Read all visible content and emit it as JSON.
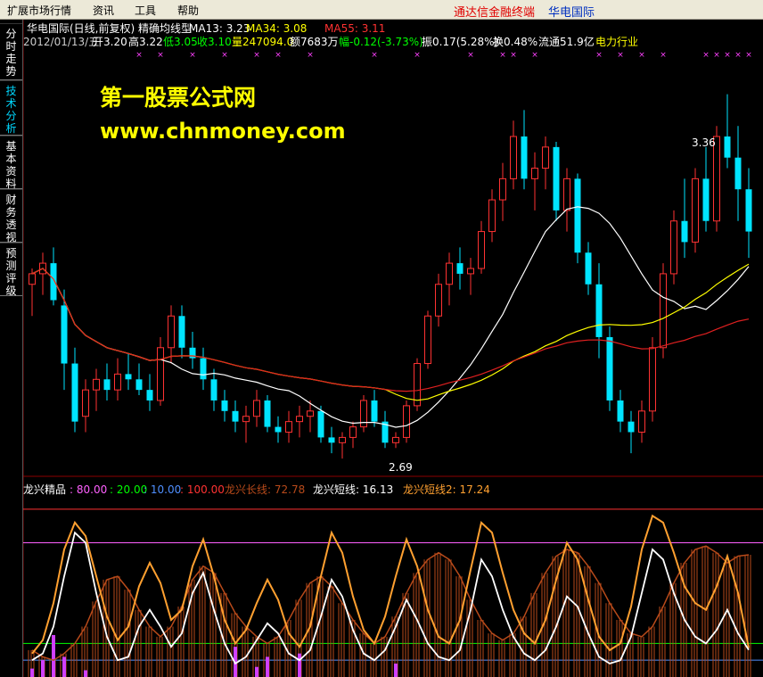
{
  "menu": {
    "items": [
      "扩展市场行情",
      "资讯",
      "工具",
      "帮助"
    ],
    "brand": "通达信金融终端",
    "stock_name": "华电国际"
  },
  "sidebar": {
    "tabs": [
      "分时走势",
      "技术分析",
      "基本资料",
      "财务透视",
      "预测评级"
    ],
    "active": "技术分析"
  },
  "header": {
    "title": "华电国际(日线,前复权) 精确均线型",
    "ma13_label": "MA13: 3.23",
    "ma34_label": "MA34: 3.08",
    "ma55_label": "MA55: 3.11",
    "date": "2012/01/13/五",
    "open": "开3.20",
    "high": "高3.22",
    "low": "低3.05",
    "close": "收3.10",
    "volume": "量247094.0",
    "amount": "额7683万",
    "change": "幅-0.12(-3.73%)",
    "amplitude": "振0.17(5.28%)",
    "turnover": "换0.48%",
    "float_cap": "流通51.9亿",
    "industry": "电力行业"
  },
  "watermark": {
    "line1": "第一股票公式网",
    "line2": "www.chnmoney.com"
  },
  "annotations": {
    "high": "3.36",
    "low": "2.69"
  },
  "indicator": {
    "name": "龙兴精品",
    "v1": ": 80.00",
    "v2": ": 20.00",
    "v3": ": 10.00",
    "v4": ": 100.00",
    "long_line": "龙兴长线: 72.78",
    "short_line": "龙兴短线: 16.13",
    "short_line2": "龙兴短线2: 17.24"
  },
  "colors": {
    "up": "#ff3232",
    "down": "#00e4ff",
    "ma13": "#ffffff",
    "ma34": "#ffff00",
    "ma55": "#e02020",
    "marker": "#ff40ff",
    "long_line": "#b84a1a",
    "short_line": "#ffffff",
    "short_line2": "#ffa030",
    "line80": "#ff60ff",
    "line20": "#00ff00",
    "line10": "#4f8fff",
    "line100": "#ff3030"
  },
  "chart_data": {
    "type": "candlestick",
    "candles": [
      [
        3.0,
        3.03,
        2.94,
        3.02
      ],
      [
        3.02,
        3.06,
        2.98,
        3.04
      ],
      [
        3.04,
        3.07,
        2.96,
        2.97
      ],
      [
        2.96,
        2.99,
        2.8,
        2.85
      ],
      [
        2.85,
        2.88,
        2.72,
        2.74
      ],
      [
        2.75,
        2.82,
        2.72,
        2.8
      ],
      [
        2.8,
        2.84,
        2.76,
        2.82
      ],
      [
        2.82,
        2.85,
        2.78,
        2.8
      ],
      [
        2.8,
        2.86,
        2.78,
        2.83
      ],
      [
        2.83,
        2.87,
        2.8,
        2.82
      ],
      [
        2.82,
        2.85,
        2.79,
        2.8
      ],
      [
        2.8,
        2.83,
        2.76,
        2.78
      ],
      [
        2.78,
        2.9,
        2.77,
        2.88
      ],
      [
        2.88,
        2.96,
        2.85,
        2.94
      ],
      [
        2.94,
        2.96,
        2.86,
        2.88
      ],
      [
        2.88,
        2.91,
        2.84,
        2.86
      ],
      [
        2.86,
        2.88,
        2.8,
        2.82
      ],
      [
        2.82,
        2.84,
        2.76,
        2.78
      ],
      [
        2.78,
        2.8,
        2.74,
        2.76
      ],
      [
        2.76,
        2.78,
        2.72,
        2.74
      ],
      [
        2.74,
        2.77,
        2.7,
        2.75
      ],
      [
        2.75,
        2.8,
        2.73,
        2.78
      ],
      [
        2.78,
        2.79,
        2.72,
        2.73
      ],
      [
        2.73,
        2.75,
        2.7,
        2.72
      ],
      [
        2.72,
        2.76,
        2.7,
        2.74
      ],
      [
        2.74,
        2.77,
        2.71,
        2.75
      ],
      [
        2.75,
        2.78,
        2.72,
        2.76
      ],
      [
        2.76,
        2.77,
        2.7,
        2.71
      ],
      [
        2.71,
        2.73,
        2.68,
        2.7
      ],
      [
        2.7,
        2.72,
        2.67,
        2.71
      ],
      [
        2.71,
        2.74,
        2.69,
        2.73
      ],
      [
        2.73,
        2.79,
        2.72,
        2.78
      ],
      [
        2.78,
        2.8,
        2.73,
        2.74
      ],
      [
        2.74,
        2.76,
        2.69,
        2.7
      ],
      [
        2.7,
        2.72,
        2.69,
        2.71
      ],
      [
        2.71,
        2.78,
        2.7,
        2.77
      ],
      [
        2.77,
        2.86,
        2.76,
        2.85
      ],
      [
        2.85,
        2.95,
        2.84,
        2.94
      ],
      [
        2.94,
        3.02,
        2.92,
        3.0
      ],
      [
        3.0,
        3.06,
        2.96,
        3.04
      ],
      [
        3.04,
        3.07,
        2.99,
        3.02
      ],
      [
        3.02,
        3.05,
        2.98,
        3.03
      ],
      [
        3.03,
        3.12,
        3.02,
        3.1
      ],
      [
        3.1,
        3.18,
        3.08,
        3.16
      ],
      [
        3.16,
        3.23,
        3.12,
        3.2
      ],
      [
        3.2,
        3.31,
        3.18,
        3.28
      ],
      [
        3.28,
        3.33,
        3.18,
        3.2
      ],
      [
        3.2,
        3.25,
        3.14,
        3.22
      ],
      [
        3.22,
        3.28,
        3.18,
        3.26
      ],
      [
        3.26,
        3.27,
        3.12,
        3.14
      ],
      [
        3.14,
        3.22,
        3.1,
        3.2
      ],
      [
        3.2,
        3.21,
        3.04,
        3.06
      ],
      [
        3.06,
        3.08,
        2.98,
        3.0
      ],
      [
        3.0,
        3.04,
        2.86,
        2.9
      ],
      [
        2.9,
        2.92,
        2.76,
        2.78
      ],
      [
        2.78,
        2.8,
        2.72,
        2.74
      ],
      [
        2.74,
        2.76,
        2.68,
        2.72
      ],
      [
        2.72,
        2.78,
        2.7,
        2.76
      ],
      [
        2.76,
        2.9,
        2.74,
        2.88
      ],
      [
        2.88,
        3.04,
        2.86,
        3.02
      ],
      [
        3.02,
        3.14,
        3.0,
        3.12
      ],
      [
        3.12,
        3.2,
        3.05,
        3.08
      ],
      [
        3.08,
        3.22,
        3.06,
        3.2
      ],
      [
        3.2,
        3.26,
        3.1,
        3.12
      ],
      [
        3.12,
        3.3,
        3.1,
        3.28
      ],
      [
        3.28,
        3.36,
        3.22,
        3.24
      ],
      [
        3.24,
        3.3,
        3.12,
        3.18
      ],
      [
        3.18,
        3.22,
        3.05,
        3.1
      ]
    ],
    "y_range": [
      2.66,
      3.4
    ],
    "marker_columns": [
      10,
      12,
      15,
      18,
      21,
      23,
      26,
      32,
      36,
      41,
      44,
      45,
      47,
      53,
      55,
      57,
      59,
      63,
      64,
      65,
      66,
      67
    ],
    "oscillator": {
      "y_range": [
        0,
        110
      ],
      "levels": [
        80,
        20,
        10,
        100
      ],
      "long_line": [
        16,
        12,
        10,
        14,
        20,
        30,
        45,
        58,
        60,
        52,
        40,
        30,
        24,
        30,
        42,
        58,
        66,
        62,
        50,
        38,
        30,
        24,
        20,
        24,
        34,
        46,
        56,
        60,
        54,
        44,
        34,
        26,
        20,
        24,
        36,
        50,
        62,
        70,
        74,
        70,
        60,
        46,
        34,
        26,
        22,
        26,
        36,
        50,
        62,
        72,
        76,
        74,
        66,
        56,
        44,
        34,
        26,
        24,
        30,
        42,
        56,
        68,
        76,
        78,
        74,
        68,
        72,
        72.78
      ],
      "short_line": [
        10,
        14,
        30,
        60,
        86,
        80,
        50,
        24,
        10,
        12,
        30,
        40,
        30,
        18,
        26,
        50,
        62,
        40,
        20,
        8,
        12,
        22,
        32,
        26,
        14,
        10,
        16,
        36,
        58,
        48,
        28,
        14,
        10,
        16,
        30,
        46,
        34,
        20,
        12,
        10,
        16,
        40,
        70,
        60,
        40,
        24,
        14,
        10,
        16,
        30,
        48,
        42,
        26,
        12,
        8,
        10,
        24,
        50,
        76,
        70,
        50,
        34,
        24,
        20,
        28,
        40,
        26,
        16.13
      ],
      "short_line2": [
        14,
        22,
        44,
        76,
        92,
        84,
        60,
        36,
        22,
        30,
        54,
        68,
        56,
        34,
        40,
        66,
        82,
        60,
        34,
        20,
        28,
        44,
        58,
        46,
        26,
        18,
        30,
        60,
        86,
        74,
        48,
        28,
        20,
        36,
        60,
        82,
        66,
        40,
        24,
        20,
        34,
        64,
        92,
        86,
        62,
        40,
        26,
        20,
        34,
        58,
        80,
        70,
        46,
        24,
        16,
        20,
        42,
        76,
        96,
        92,
        74,
        54,
        44,
        40,
        54,
        72,
        50,
        17.24
      ],
      "purple_bars": [
        5,
        10,
        25,
        12,
        0,
        4,
        0,
        0,
        0,
        0,
        0,
        0,
        0,
        0,
        0,
        0,
        0,
        0,
        0,
        18,
        0,
        6,
        12,
        0,
        0,
        14,
        0,
        0,
        0,
        0,
        0,
        0,
        0,
        0,
        8,
        0,
        0,
        0,
        0,
        0,
        0,
        0,
        0,
        0,
        0,
        0,
        0,
        0,
        0,
        0,
        0,
        0,
        0,
        0,
        0,
        0,
        0,
        0,
        0,
        0,
        0,
        0,
        0,
        0,
        0,
        0,
        0,
        0
      ]
    }
  }
}
